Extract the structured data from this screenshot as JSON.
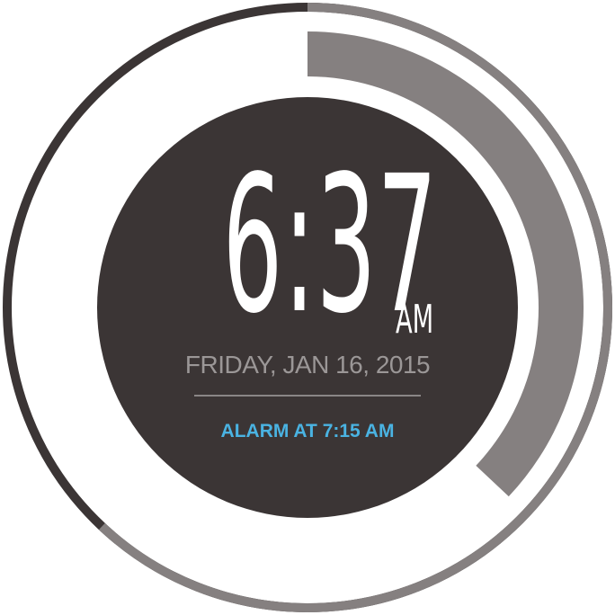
{
  "clock": {
    "time": "6:37",
    "meridiem": "AM",
    "date": "FRIDAY, JAN 16, 2015",
    "alarm": "ALARM AT 7:15 AM"
  },
  "rings": {
    "outer_progress_fraction": 0.62,
    "inner_progress_fraction": 0.37
  },
  "colors": {
    "face": "#3b3535",
    "ring_dark": "#3b3535",
    "ring_gray": "#858080",
    "date_text": "#9b9797",
    "alarm_text": "#4ab3e2",
    "digits": "#ffffff"
  }
}
